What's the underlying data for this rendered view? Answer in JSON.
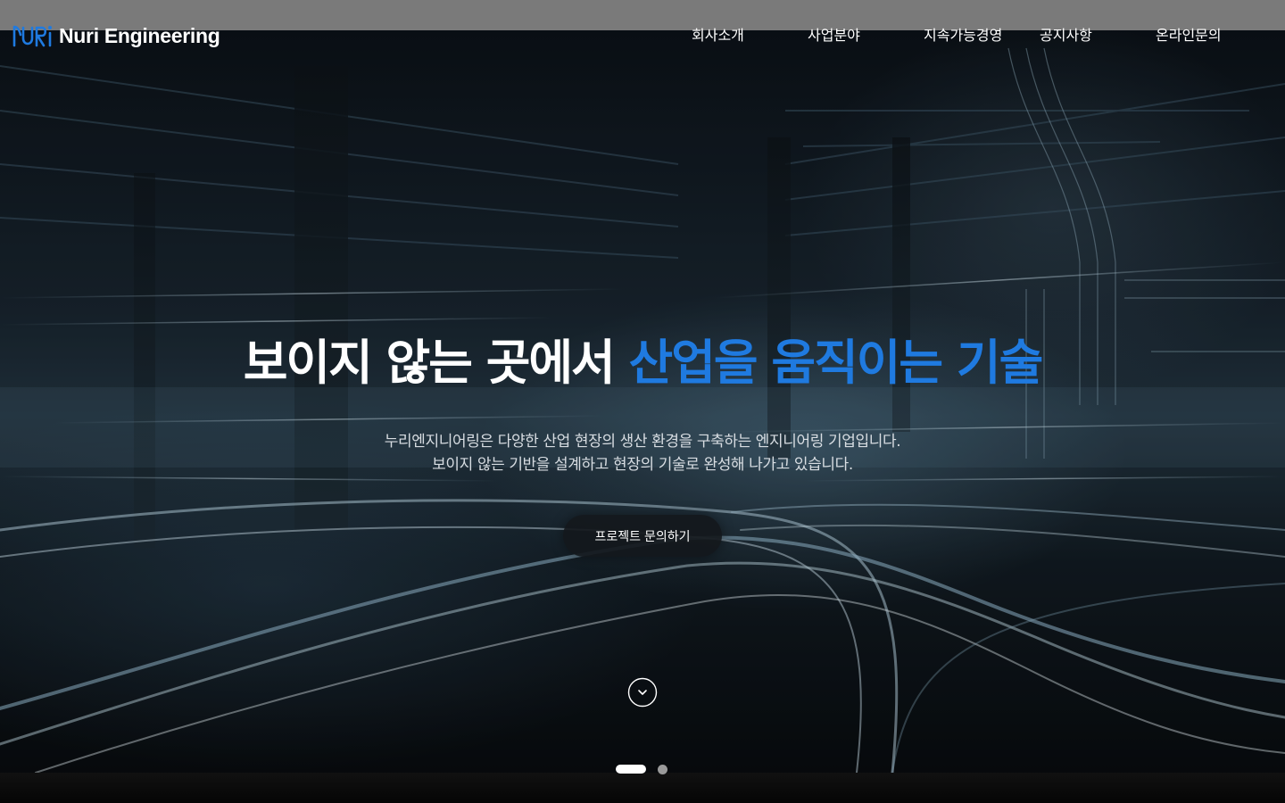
{
  "brand": {
    "logo_icon": "nuri-logo-icon",
    "name": "Nuri Engineering"
  },
  "nav": {
    "items": [
      {
        "label": "회사소개"
      },
      {
        "label": "사업분야"
      },
      {
        "label": "지속가능경영"
      },
      {
        "label": "공지사항"
      },
      {
        "label": "온라인문의"
      }
    ]
  },
  "hero": {
    "headline_white": "보이지 않는 곳에서 ",
    "headline_accent": "산업을 움직이는 기술",
    "subcopy": [
      "누리엔지니어링은 다양한 산업 현장의 생산 환경을 구축하는 엔지니어링 기업입니다.",
      "보이지 않는 기반을 설계하고 현장의 기술로 완성해 나가고 있습니다."
    ],
    "cta_label": "프로젝트 문의하기",
    "scroll_icon": "chevron-down-icon"
  },
  "slider": {
    "count": 2,
    "active_index": 0
  },
  "colors": {
    "accent": "#1f7ae0",
    "topbar": "#7a7a7a",
    "cta_bg": "#14181c",
    "text": "#ffffff"
  }
}
